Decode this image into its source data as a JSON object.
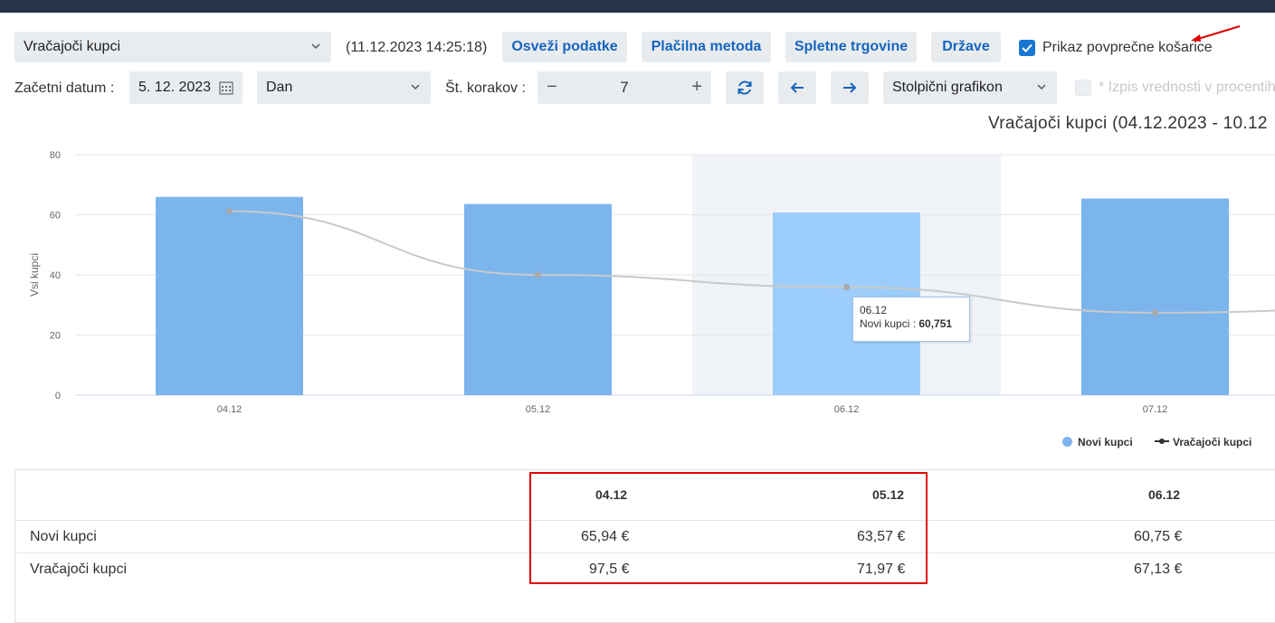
{
  "toolbar": {
    "report_select": "Vračajoči kupci",
    "timestamp": "(11.12.2023 14:25:18)",
    "refresh_label": "Osveži podatke",
    "payment_label": "Plačilna metoda",
    "shops_label": "Spletne trgovine",
    "countries_label": "Države",
    "avg_basket_label": "Prikaz povprečne košarice",
    "avg_basket_checked": true
  },
  "filters": {
    "start_date_label": "Začetni datum :",
    "start_date_value": "5. 12. 2023",
    "period_select": "Dan",
    "steps_label": "Št. korakov :",
    "steps_value": "7",
    "chart_type_select": "Stolpični grafikon",
    "percent_label": "* Izpis vrednosti v procentih",
    "percent_checked": false
  },
  "chart_data": {
    "type": "bar",
    "title": "Vračajoči kupci (04.12.2023 - 10.12",
    "ylabel": "Vsi kupci",
    "xlabel": "",
    "ylim": [
      0,
      80
    ],
    "yticks": [
      "0",
      "20",
      "40",
      "60",
      "80"
    ],
    "categories": [
      "04.12",
      "05.12",
      "06.12",
      "07.12"
    ],
    "highlighted_index": 2,
    "series": [
      {
        "name": "Novi kupci",
        "kind": "bar",
        "color": "#7cb5ec",
        "values": [
          65.94,
          63.57,
          60.75,
          65.4
        ]
      },
      {
        "name": "Vračajoči kupci",
        "kind": "line",
        "color": "#c9c9c9",
        "values": [
          61.2,
          40.0,
          35.9,
          27.4
        ]
      }
    ]
  },
  "tooltip": {
    "date": "06.12",
    "series": "Novi kupci : ",
    "value": "60,751"
  },
  "legend": {
    "new_label": "Novi kupci",
    "returning_label": "Vračajoči kupci"
  },
  "table": {
    "headers": [
      "04.12",
      "05.12",
      "06.12"
    ],
    "rows": [
      {
        "label": "Novi kupci",
        "cells": [
          "65,94 €",
          "63,57 €",
          "60,75 €"
        ]
      },
      {
        "label": "Vračajoči kupci",
        "cells": [
          "97,5 €",
          "71,97 €",
          "67,13 €"
        ]
      }
    ]
  },
  "colors": {
    "accent": "#1976d2",
    "annotation_red": "#e00000"
  }
}
